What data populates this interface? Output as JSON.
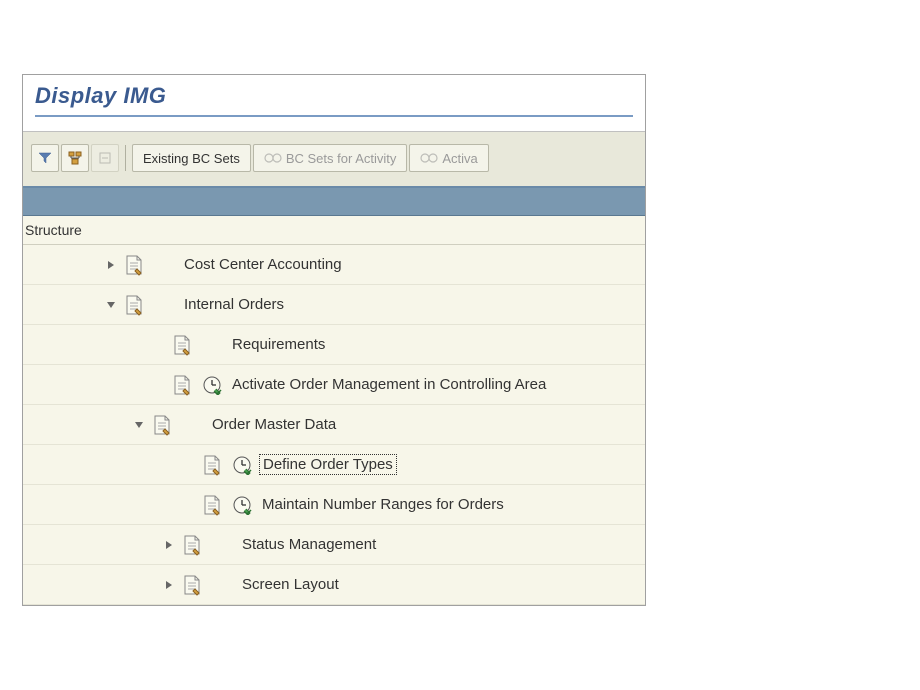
{
  "title": "Display IMG",
  "toolbar": {
    "existing_bc_sets": "Existing BC Sets",
    "bc_sets_for_activity": "BC Sets for Activity",
    "activated": "Activa"
  },
  "structure": {
    "header": "Structure",
    "nodes": [
      {
        "indent": 80,
        "toggle": "closed",
        "doc": true,
        "clock": false,
        "label": "Cost Center Accounting",
        "selected": false
      },
      {
        "indent": 80,
        "toggle": "open",
        "doc": true,
        "clock": false,
        "label": "Internal Orders",
        "selected": false
      },
      {
        "indent": 128,
        "toggle": "none",
        "doc": true,
        "clock": false,
        "label": "Requirements",
        "selected": false
      },
      {
        "indent": 128,
        "toggle": "none",
        "doc": true,
        "clock": true,
        "label": "Activate Order Management in Controlling Area",
        "selected": false
      },
      {
        "indent": 108,
        "toggle": "open",
        "doc": true,
        "clock": false,
        "label": "Order Master Data",
        "selected": false
      },
      {
        "indent": 158,
        "toggle": "none",
        "doc": true,
        "clock": true,
        "label": "Define Order Types",
        "selected": true
      },
      {
        "indent": 158,
        "toggle": "none",
        "doc": true,
        "clock": true,
        "label": "Maintain Number Ranges for Orders",
        "selected": false
      },
      {
        "indent": 138,
        "toggle": "closed",
        "doc": true,
        "clock": false,
        "label": "Status Management",
        "selected": false
      },
      {
        "indent": 138,
        "toggle": "closed",
        "doc": true,
        "clock": false,
        "label": "Screen Layout",
        "selected": false
      }
    ]
  }
}
